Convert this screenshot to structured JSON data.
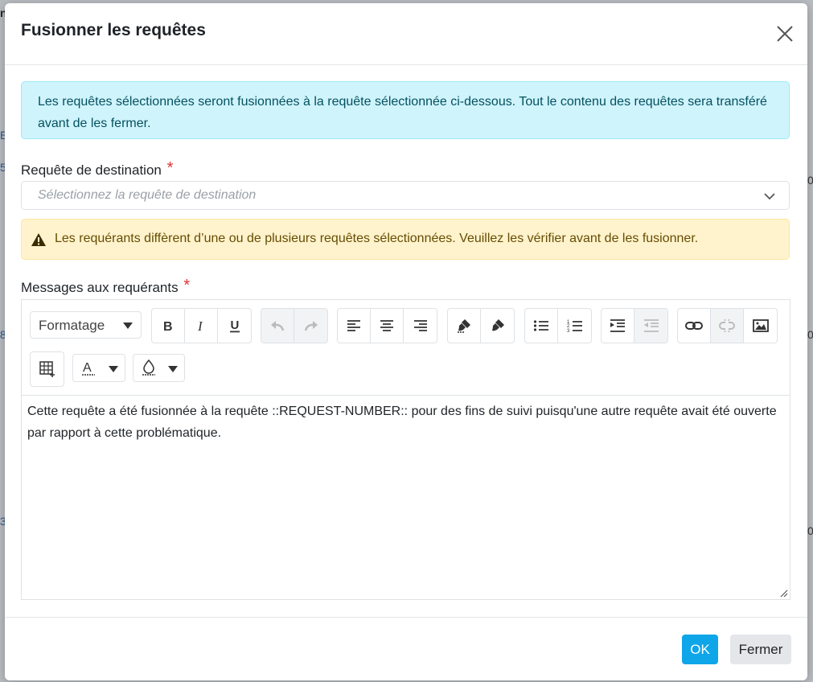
{
  "dialog": {
    "title": "Fusionner les requêtes",
    "info_message": "Les requêtes sélectionnées seront fusionnées à la requête sélectionnée ci-dessous. Tout le contenu des requêtes sera transféré avant de les fermer.",
    "destination_label": "Requête de destination",
    "required_mark": "*",
    "destination_placeholder": "Sélectionnez la requête de destination",
    "warning_message": "Les requérants diffèrent d’une ou de plusieurs requêtes sélectionnées. Veuillez les vérifier avant de les fusionner.",
    "messages_label": "Messages aux requérants"
  },
  "editor": {
    "format_select": "Formatage",
    "content": "Cette requête a été fusionnée à la requête ::REQUEST-NUMBER:: pour des fins de suivi puisqu'une autre requête avait été ouverte par rapport à cette problématique."
  },
  "footer": {
    "ok_label": "OK",
    "close_label": "Fermer"
  },
  "colors": {
    "info_bg": "#cff4fc",
    "warning_bg": "#fff3cd",
    "primary": "#0ea5e9",
    "required": "#e03131"
  }
}
